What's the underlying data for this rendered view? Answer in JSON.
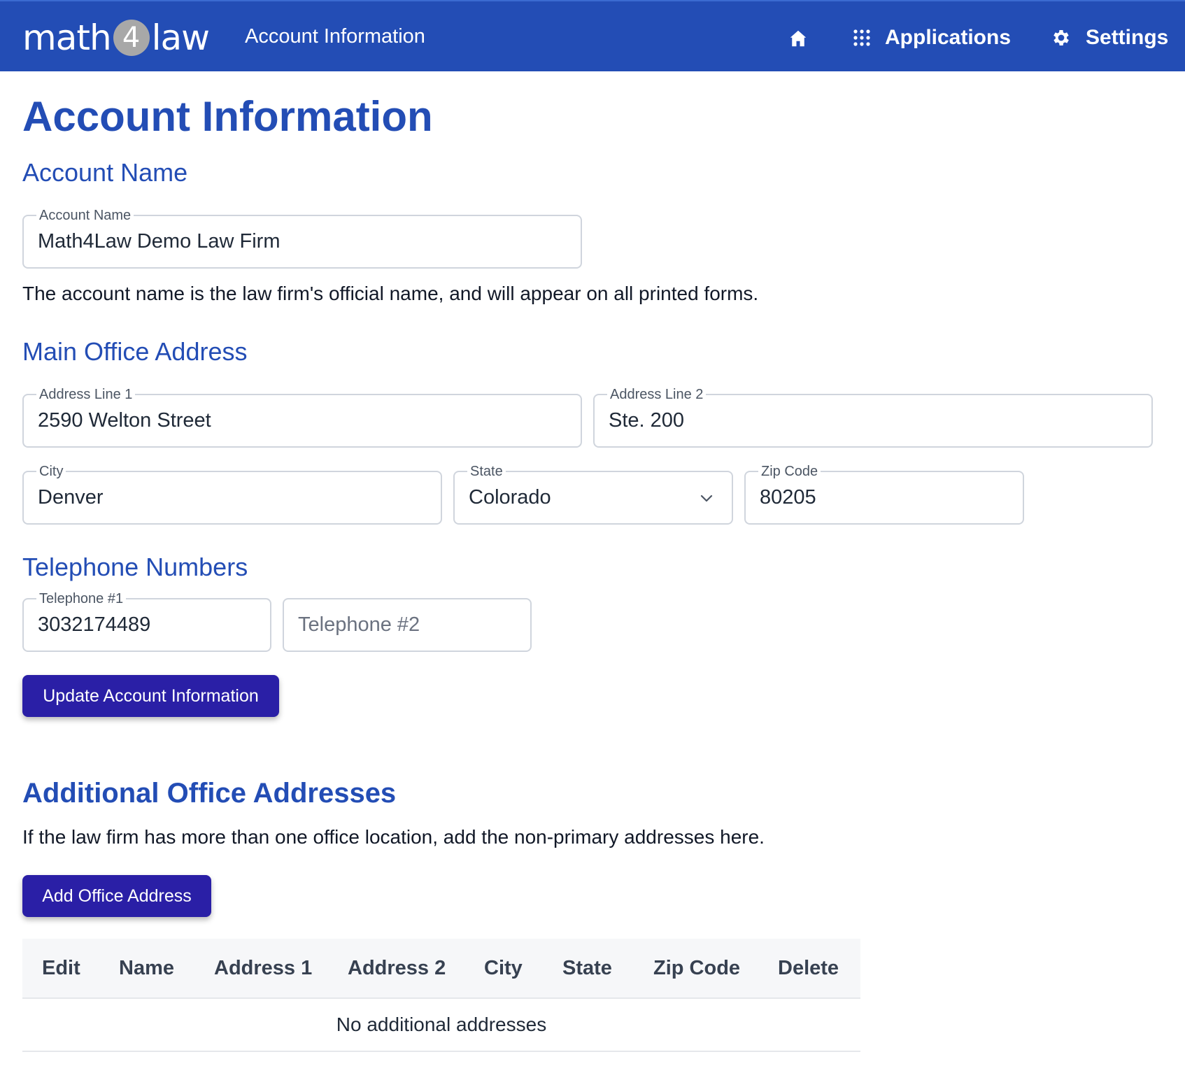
{
  "header": {
    "logo_left": "math",
    "logo_digit": "4",
    "logo_right": "law",
    "title": "Account Information",
    "home_icon": "home-icon",
    "applications_label": "Applications",
    "settings_label": "Settings"
  },
  "page": {
    "title": "Account Information"
  },
  "account_name": {
    "section_title": "Account Name",
    "field_label": "Account Name",
    "value": "Math4Law Demo Law Firm",
    "help_text": "The account name is the law firm's official name, and will appear on all printed forms."
  },
  "address": {
    "section_title": "Main Office Address",
    "line1_label": "Address Line 1",
    "line1_value": "2590 Welton Street",
    "line2_label": "Address Line 2",
    "line2_value": "Ste. 200",
    "city_label": "City",
    "city_value": "Denver",
    "state_label": "State",
    "state_value": "Colorado",
    "zip_label": "Zip Code",
    "zip_value": "80205"
  },
  "phones": {
    "section_title": "Telephone Numbers",
    "phone1_label": "Telephone #1",
    "phone1_value": "3032174489",
    "phone2_placeholder": "Telephone #2"
  },
  "update_button": "Update Account Information",
  "additional": {
    "section_title": "Additional Office Addresses",
    "help_text": "If the law firm has more than one office location, add the non-primary addresses here.",
    "add_button": "Add Office Address",
    "columns": [
      "Edit",
      "Name",
      "Address 1",
      "Address 2",
      "City",
      "State",
      "Zip Code",
      "Delete"
    ],
    "empty_text": "No additional addresses"
  },
  "colors": {
    "header_bg": "#234db5",
    "heading": "#234db5",
    "button_bg": "#2a1fa6"
  }
}
